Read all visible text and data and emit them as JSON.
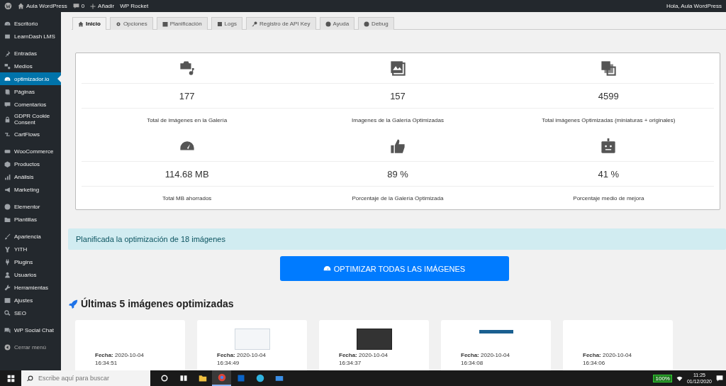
{
  "admin_bar": {
    "site": "Aula WordPress",
    "comments": "0",
    "add": "Añadir",
    "plugin": "WP Rocket",
    "greeting": "Hola, Aula WordPress"
  },
  "sidebar": {
    "groups": [
      {
        "items": [
          {
            "label": "Escritorio",
            "selected": false
          },
          {
            "label": "LearnDash LMS",
            "selected": false
          }
        ]
      },
      {
        "items": [
          {
            "label": "Entradas",
            "selected": false
          },
          {
            "label": "Medios",
            "selected": false
          },
          {
            "label": "optimizador.io",
            "selected": true
          },
          {
            "label": "Páginas",
            "selected": false
          },
          {
            "label": "Comentarios",
            "selected": false
          },
          {
            "label": "GDPR Cookie Consent",
            "selected": false
          },
          {
            "label": "CartFlows",
            "selected": false
          }
        ]
      },
      {
        "items": [
          {
            "label": "WooCommerce",
            "selected": false
          },
          {
            "label": "Productos",
            "selected": false
          },
          {
            "label": "Análisis",
            "selected": false
          },
          {
            "label": "Marketing",
            "selected": false
          }
        ]
      },
      {
        "items": [
          {
            "label": "Elementor",
            "selected": false
          },
          {
            "label": "Plantillas",
            "selected": false
          }
        ]
      },
      {
        "items": [
          {
            "label": "Apariencia",
            "selected": false
          },
          {
            "label": "YITH",
            "selected": false
          },
          {
            "label": "Plugins",
            "selected": false
          },
          {
            "label": "Usuarios",
            "selected": false
          },
          {
            "label": "Herramientas",
            "selected": false
          },
          {
            "label": "Ajustes",
            "selected": false
          },
          {
            "label": "SEO",
            "selected": false
          }
        ]
      },
      {
        "items": [
          {
            "label": "WP Social Chat",
            "selected": false
          }
        ]
      }
    ],
    "collapse_label": "Cerrar menú"
  },
  "tabs": [
    {
      "label": "Inicio",
      "selected": true
    },
    {
      "label": "Opciones",
      "selected": false
    },
    {
      "label": "Planificación",
      "selected": false
    },
    {
      "label": "Logs",
      "selected": false
    },
    {
      "label": "Registro de API Key",
      "selected": false
    },
    {
      "label": "Ayuda",
      "selected": false
    },
    {
      "label": "Debug",
      "selected": false
    }
  ],
  "stats": [
    {
      "value": "177",
      "label": "Total de imágenes en la Galería"
    },
    {
      "value": "157",
      "label": "Imagenes de la Galería Optimizadas"
    },
    {
      "value": "4599",
      "label": "Total imágenes Optimizadas (miniaturas + originales)"
    },
    {
      "value": "114.68 MB",
      "label": "Total MB ahorrados"
    },
    {
      "value": "89 %",
      "label": "Porcentaje de la Galería Optimizada"
    },
    {
      "value": "41 %",
      "label": "Porcentaje medio de mejora"
    }
  ],
  "notice": "Planificada la optimización de 18 imágenes",
  "optimize_button": "OPTIMIZAR TODAS LAS IMÁGENES",
  "recent": {
    "title": "Últimas 5 imágenes optimizadas",
    "items": [
      {
        "kind": "blank",
        "date_label": "Fecha:",
        "date": "2020-10-04",
        "time": "16:34:51"
      },
      {
        "kind": "light",
        "date_label": "Fecha:",
        "date": "2020-10-04",
        "time": "16:34:49"
      },
      {
        "kind": "dark",
        "date_label": "Fecha:",
        "date": "2020-10-04",
        "time": "16:34:37"
      },
      {
        "kind": "blue",
        "date_label": "Fecha:",
        "date": "2020-10-04",
        "time": "16:34:08"
      },
      {
        "kind": "blank",
        "date_label": "Fecha:",
        "date": "2020-10-04",
        "time": "16:34:06"
      }
    ]
  },
  "taskbar": {
    "search_placeholder": "Escribe aquí para buscar",
    "apps": [
      {
        "selected": false
      },
      {
        "selected": false
      },
      {
        "selected": false
      },
      {
        "selected": true
      },
      {
        "selected": false
      },
      {
        "selected": false
      },
      {
        "selected": false
      }
    ],
    "battery": "100%",
    "time": "11:25",
    "date": "01/12/2020"
  }
}
